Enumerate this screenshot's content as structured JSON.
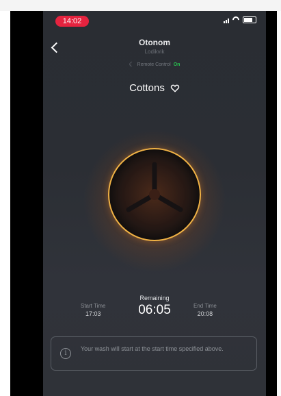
{
  "status_bar": {
    "time": "14:02",
    "icons": [
      "signal-icon",
      "wifi-icon",
      "battery-icon"
    ]
  },
  "header": {
    "title": "Otonom",
    "subtitle": "Lodikvik",
    "remote_label": "Remote Control",
    "remote_state": "On",
    "back_icon": "chevron-left-icon"
  },
  "program": {
    "name": "Cottons",
    "favorite_icon": "heart-icon"
  },
  "drum": {
    "ring_color": "#f0b245",
    "glow_color": "#e0721a"
  },
  "timing": {
    "start_label": "Start Time",
    "start_value": "17:03",
    "remaining_label": "Remaining",
    "remaining_value": "06:05",
    "end_label": "End Time",
    "end_value": "20:08"
  },
  "notice": {
    "icon": "info-icon",
    "text": "Your wash will start at the start time specified above."
  },
  "colors": {
    "accent_on": "#28c04f",
    "time_pill": "#e5233f",
    "background": "#2b2e34"
  }
}
